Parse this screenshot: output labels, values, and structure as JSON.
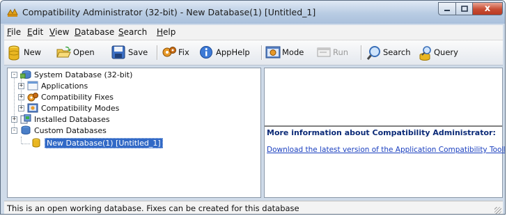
{
  "window": {
    "title": "Compatibility Administrator (32-bit) - New Database(1) [Untitled_1]",
    "minimize_glyph": "–",
    "maximize_glyph": "□",
    "close_glyph": "x"
  },
  "menu": {
    "items": [
      {
        "key": "F",
        "rest": "ile"
      },
      {
        "key": "E",
        "rest": "dit"
      },
      {
        "key": "V",
        "rest": "iew"
      },
      {
        "key": "D",
        "rest": "atabase"
      },
      {
        "key": "S",
        "rest": "earch"
      },
      {
        "key": "H",
        "rest": "elp"
      }
    ]
  },
  "toolbar": {
    "new_label": "New",
    "open_label": "Open",
    "save_label": "Save",
    "fix_label": "Fix",
    "apphelp_label": "AppHelp",
    "mode_label": "Mode",
    "run_label": "Run",
    "search_label": "Search",
    "query_label": "Query"
  },
  "tree": {
    "system_db": "System Database (32-bit)",
    "applications": "Applications",
    "compat_fixes": "Compatibility Fixes",
    "compat_modes": "Compatibility Modes",
    "installed_db": "Installed Databases",
    "custom_db": "Custom Databases",
    "new_db": "New Database(1) [Untitled_1]",
    "expanded_glyph": "-",
    "collapsed_glyph": "+"
  },
  "info": {
    "title": "More information about Compatibility Administrator:",
    "link": "Download the latest version of the Application Compatibility Toolkit"
  },
  "status": {
    "text": "This is an open working database. Fixes can be created for this database"
  },
  "colors": {
    "selection": "#3169c6",
    "link": "#1a3fbf",
    "info_title": "#0b2a77"
  }
}
